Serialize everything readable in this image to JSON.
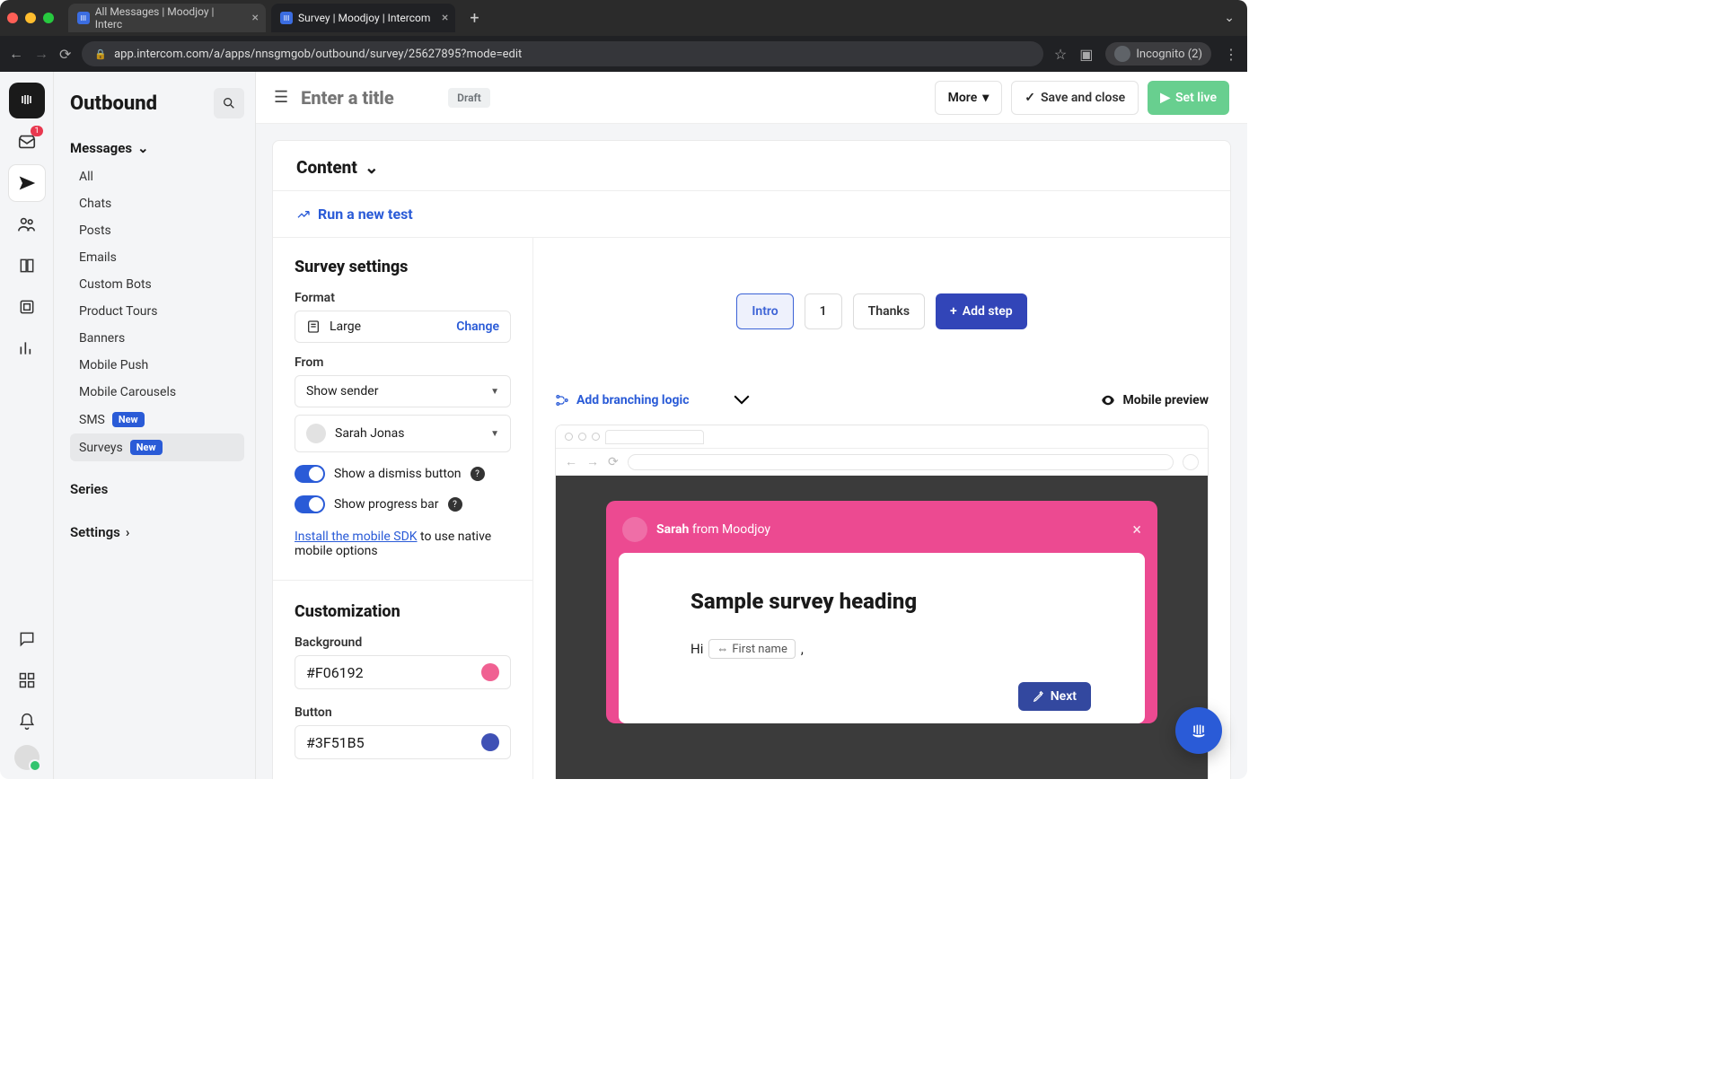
{
  "browser": {
    "tabs": [
      {
        "title": "All Messages | Moodjoy | Interc",
        "active": false
      },
      {
        "title": "Survey | Moodjoy | Intercom",
        "active": true
      }
    ],
    "url": "app.intercom.com/a/apps/nnsgmgob/outbound/survey/25627895?mode=edit",
    "incognito_label": "Incognito (2)"
  },
  "rail": {
    "inbox_badge": "1"
  },
  "sidebar": {
    "title": "Outbound",
    "messages_group": "Messages",
    "items": [
      "All",
      "Chats",
      "Posts",
      "Emails",
      "Custom Bots",
      "Product Tours",
      "Banners",
      "Mobile Push",
      "Mobile Carousels"
    ],
    "sms": {
      "label": "SMS",
      "badge": "New"
    },
    "surveys": {
      "label": "Surveys",
      "badge": "New"
    },
    "series": "Series",
    "settings": "Settings"
  },
  "topbar": {
    "title_placeholder": "Enter a title",
    "draft": "Draft",
    "more": "More",
    "save": "Save and close",
    "live": "Set live"
  },
  "content": {
    "heading": "Content",
    "run_test": "Run a new test"
  },
  "settings": {
    "heading": "Survey settings",
    "format_label": "Format",
    "format_value": "Large",
    "change": "Change",
    "from_label": "From",
    "from_mode": "Show sender",
    "from_user": "Sarah Jonas",
    "dismiss": "Show a dismiss button",
    "progress": "Show progress bar",
    "sdk_link": "Install the mobile SDK",
    "sdk_text": " to use native mobile options",
    "custom_heading": "Customization",
    "bg_label": "Background",
    "bg_value": "#F06192",
    "btn_label": "Button",
    "btn_value": "#3F51B5"
  },
  "steps": {
    "intro": "Intro",
    "one": "1",
    "thanks": "Thanks",
    "add": "Add step"
  },
  "preview": {
    "branch": "Add branching logic",
    "mobile": "Mobile preview",
    "sender_name": "Sarah",
    "sender_from": " from Moodjoy",
    "survey_heading": "Sample survey heading",
    "hi": "Hi",
    "var": "First name",
    "comma": ",",
    "next": "Next"
  }
}
